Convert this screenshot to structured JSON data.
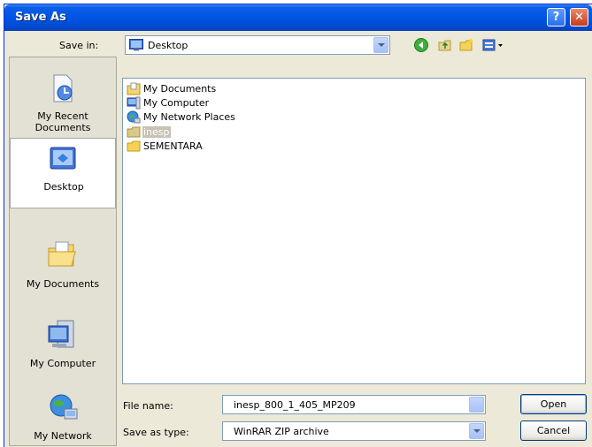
{
  "window": {
    "title": "Save As"
  },
  "titlebar_buttons": {
    "help": "?",
    "close": "✕"
  },
  "savein": {
    "label": "Save in:",
    "value": "Desktop",
    "icon": "desktop-icon"
  },
  "toolbar": {
    "icons": [
      "back-icon",
      "up-folder-icon",
      "new-folder-icon",
      "views-menu-icon"
    ]
  },
  "places": [
    {
      "label": "My Recent Documents",
      "icon": "recent-documents-icon"
    },
    {
      "label": "Desktop",
      "icon": "desktop-icon",
      "selected": true
    },
    {
      "label": "My Documents",
      "icon": "my-documents-icon"
    },
    {
      "label": "My Computer",
      "icon": "my-computer-icon"
    },
    {
      "label": "My Network",
      "icon": "network-places-icon"
    }
  ],
  "files": [
    {
      "name": "My Documents",
      "icon": "my-documents-icon"
    },
    {
      "name": "My Computer",
      "icon": "my-computer-icon"
    },
    {
      "name": "My Network Places",
      "icon": "network-places-icon"
    },
    {
      "name": "inesp",
      "icon": "folder-icon",
      "selected": true
    },
    {
      "name": "SEMENTARA",
      "icon": "folder-icon"
    }
  ],
  "filename": {
    "label": "File name:",
    "value": "inesp_800_1_405_MP209"
  },
  "filetype": {
    "label": "Save as type:",
    "value": "WinRAR ZIP archive"
  },
  "buttons": {
    "open": "Open",
    "cancel": "Cancel"
  },
  "colors": {
    "titlebar": "#0054e3",
    "dialog_bg": "#ece9d8",
    "selection": "#c6c3b5"
  }
}
